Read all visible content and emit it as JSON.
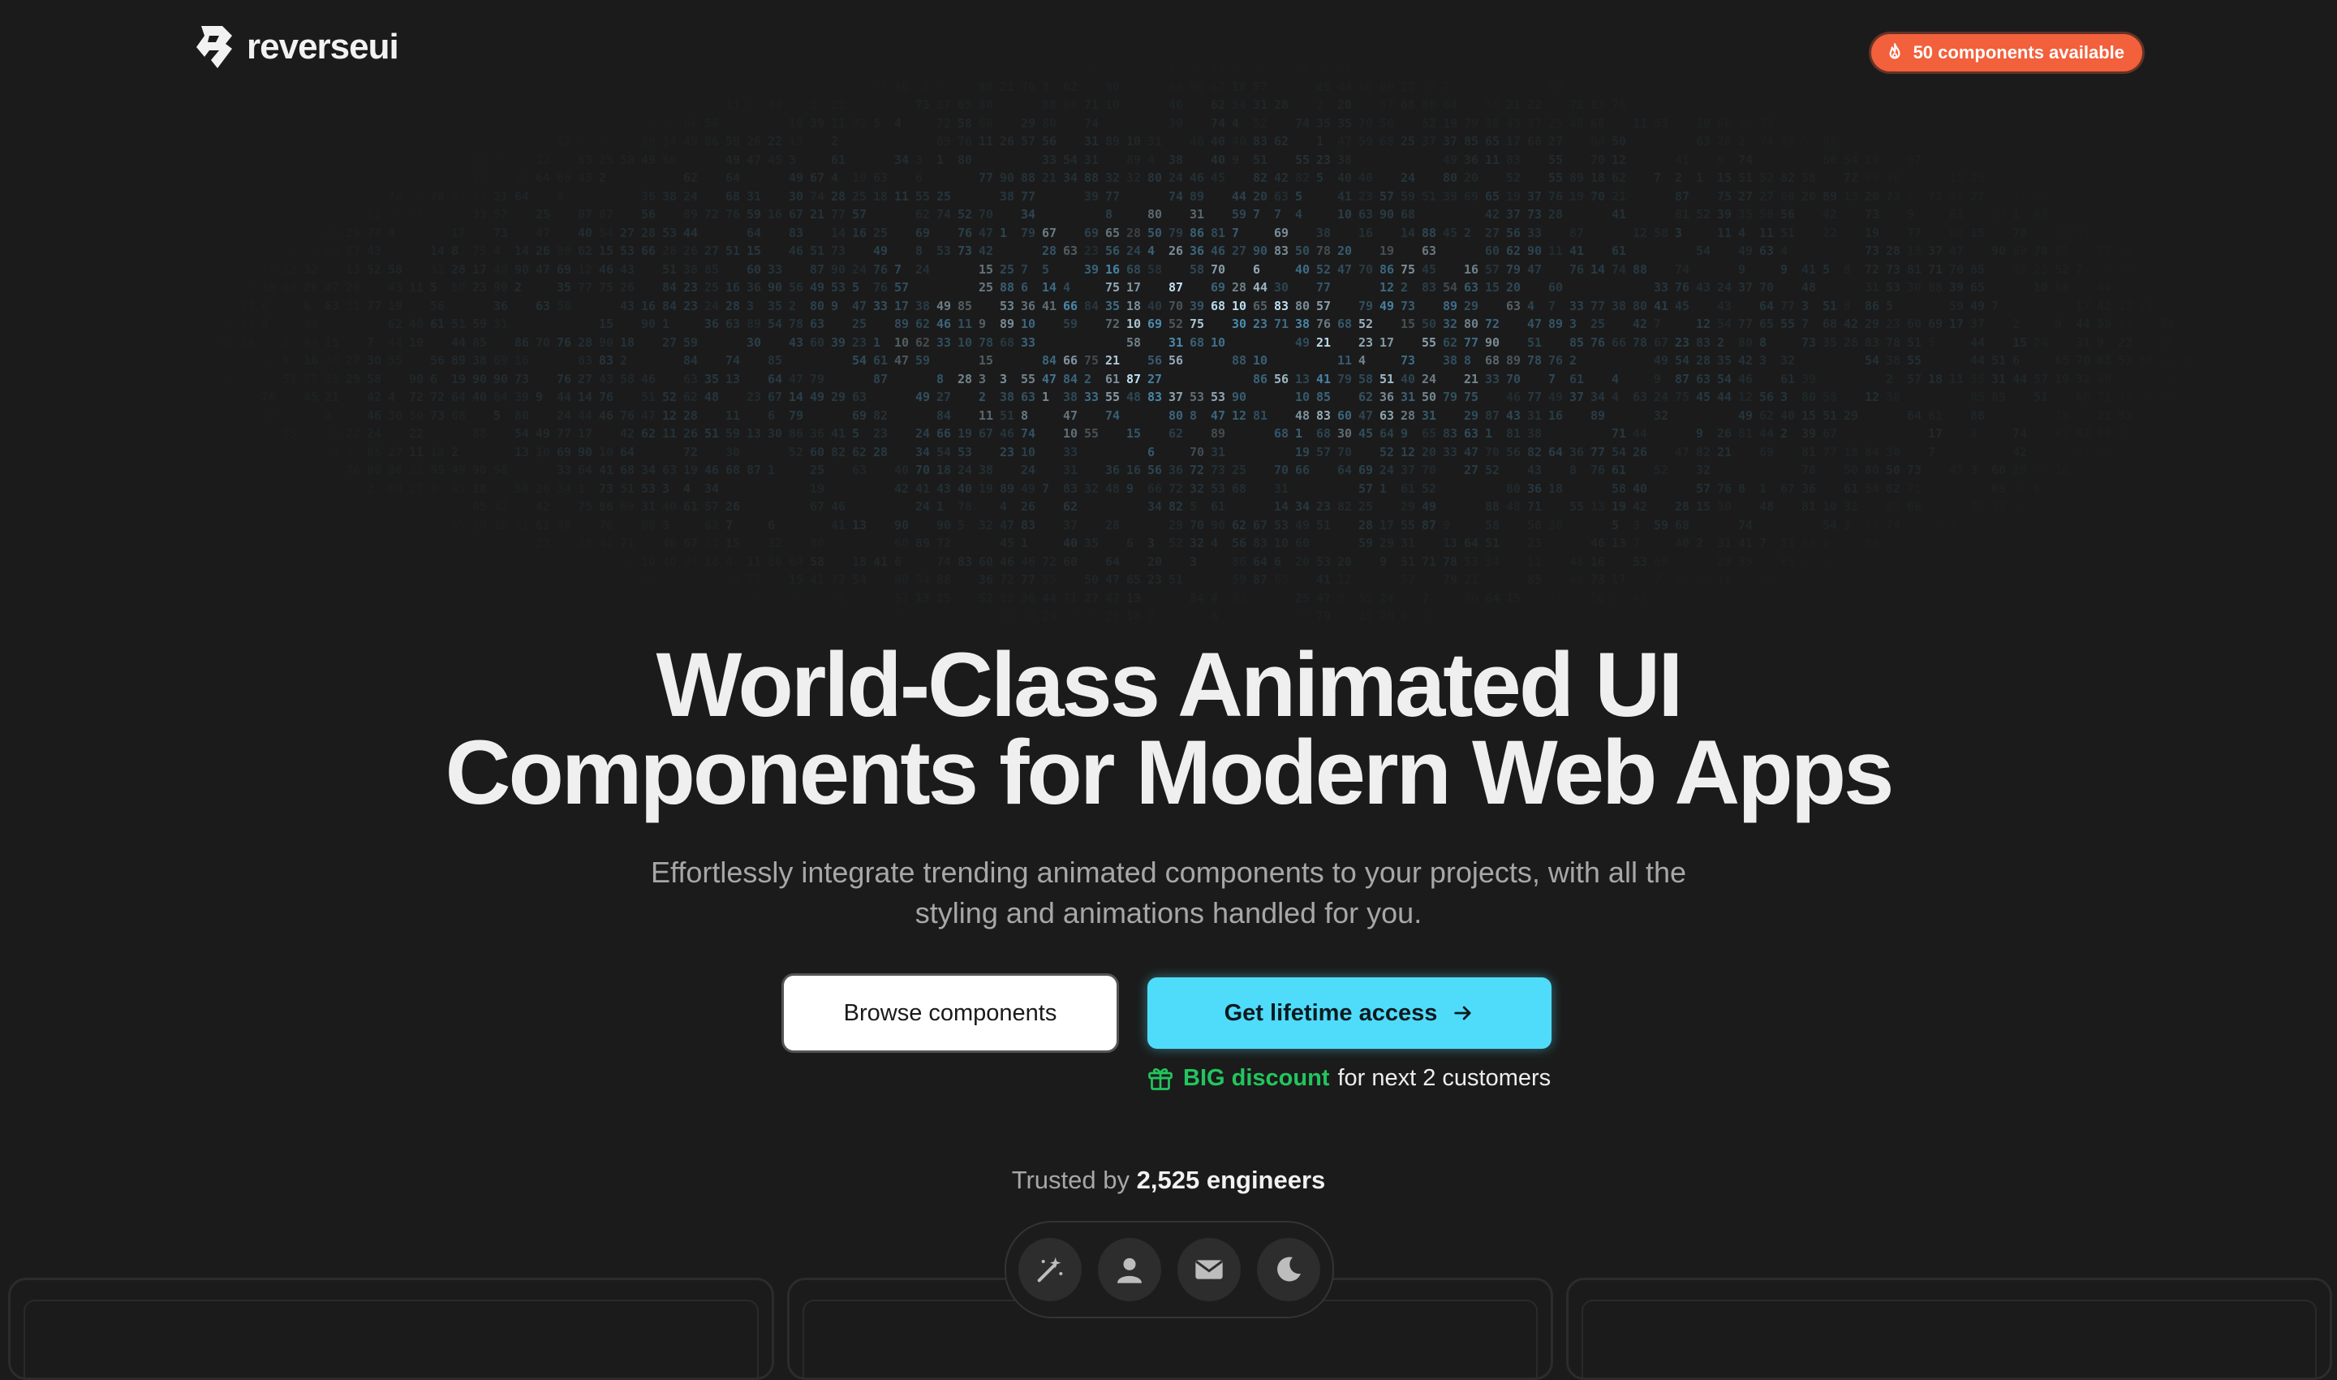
{
  "brand": {
    "name": "reverseui",
    "logo_icon": "reverseui-logo-icon"
  },
  "badge": {
    "label": "50 components available",
    "icon": "fire-icon",
    "color": "#f2603c"
  },
  "hero": {
    "headline_line1": "World-Class Animated UI",
    "headline_line2": "Components for Modern Web Apps",
    "sub_line1": "Effortlessly integrate trending animated components to your projects, with all the",
    "sub_line2": "styling and animations handled for you."
  },
  "cta": {
    "browse_label": "Browse components",
    "access_label": "Get lifetime access",
    "access_icon": "arrow-right-icon",
    "access_color": "#4fdcfb"
  },
  "discount": {
    "icon": "gift-icon",
    "highlight": "BIG discount",
    "rest": "for next 2 customers",
    "color": "#22c55e"
  },
  "trusted": {
    "prefix": "Trusted by",
    "count": "2,525 engineers"
  },
  "dock": {
    "items": [
      {
        "icon": "magic-wand-icon"
      },
      {
        "icon": "user-icon"
      },
      {
        "icon": "mail-icon"
      },
      {
        "icon": "moon-icon"
      }
    ]
  },
  "colors": {
    "background": "#1b1b1b",
    "matrix_glow": "#7fd6ff"
  }
}
